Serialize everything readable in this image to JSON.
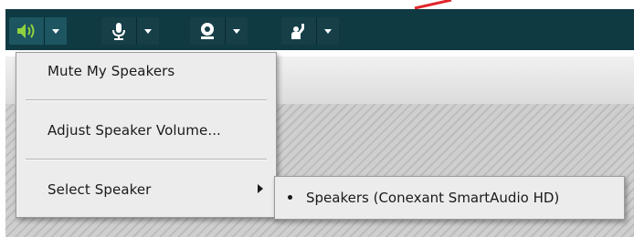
{
  "colors": {
    "toolbar_bg": "#0f3a42",
    "speaker_icon": "#8fd13f",
    "menu_bg": "#ececec",
    "annotation_arrow": "#e0262a"
  },
  "toolbar": {
    "buttons": [
      {
        "icon": "speaker-icon",
        "active": true
      },
      {
        "icon": "microphone-icon",
        "active": false
      },
      {
        "icon": "webcam-icon",
        "active": false
      },
      {
        "icon": "raise-hand-icon",
        "active": false
      }
    ]
  },
  "speaker_menu": {
    "items": [
      {
        "label": "Mute My Speakers"
      },
      {
        "label": "Adjust Speaker Volume..."
      },
      {
        "label": "Select Speaker",
        "has_submenu": true
      }
    ]
  },
  "select_speaker_submenu": {
    "items": [
      {
        "label": "Speakers (Conexant SmartAudio HD)",
        "selected": true
      }
    ]
  }
}
